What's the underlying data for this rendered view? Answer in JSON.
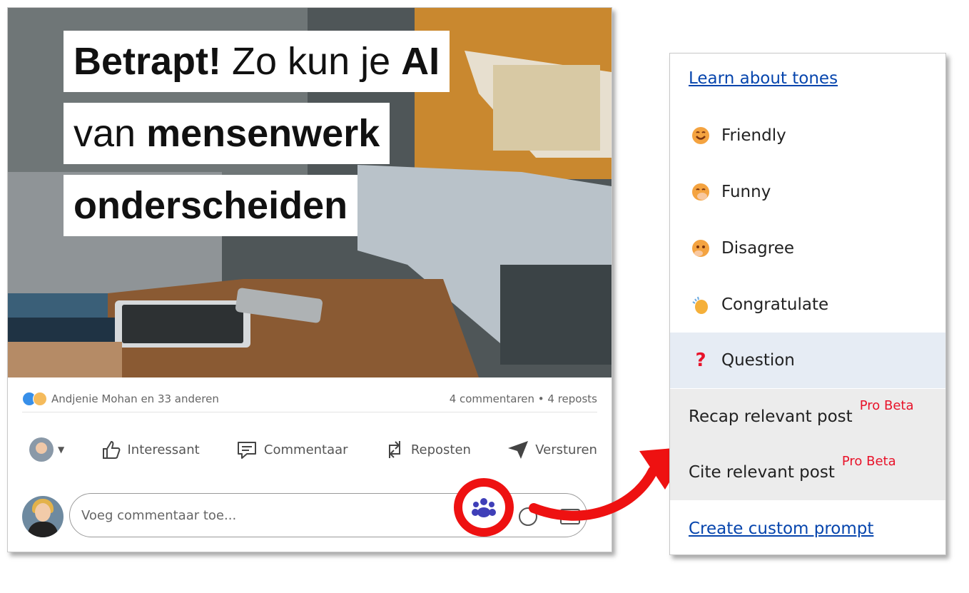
{
  "post": {
    "headline": {
      "line1_bold": "Betrapt!",
      "line1_rest": " Zo kun je ",
      "line1_bold2": "AI",
      "line2_rest": "van ",
      "line2_bold": "mensenwerk",
      "line3_bold": "onderscheiden"
    },
    "reactions_text": "Andjenie Mohan en 33 anderen",
    "stats_text": "4 commentaren • 4 reposts",
    "actions": {
      "like": "Interessant",
      "comment": "Commentaar",
      "repost": "Reposten",
      "send": "Versturen"
    },
    "comment_placeholder": "Voeg commentaar toe...",
    "extension_icon": "people-group-icon"
  },
  "tones_menu": {
    "learn_link": "Learn about tones",
    "items": [
      {
        "label": "Friendly",
        "icon": "smiling-face-icon"
      },
      {
        "label": "Funny",
        "icon": "laughing-face-icon"
      },
      {
        "label": "Disagree",
        "icon": "frowning-face-icon"
      },
      {
        "label": "Congratulate",
        "icon": "clapping-hands-icon"
      },
      {
        "label": "Question",
        "icon": "question-mark-icon",
        "highlighted": true
      }
    ],
    "pro_items": [
      {
        "label": "Recap relevant post",
        "tag": "Pro Beta"
      },
      {
        "label": "Cite relevant post",
        "tag": "Pro Beta"
      }
    ],
    "custom_link": "Create custom prompt"
  },
  "colors": {
    "highlight_ring": "#ee1111",
    "link": "#0645ad",
    "pro_tag": "#e8132a",
    "linkedin_blue": "#0a66c2"
  }
}
